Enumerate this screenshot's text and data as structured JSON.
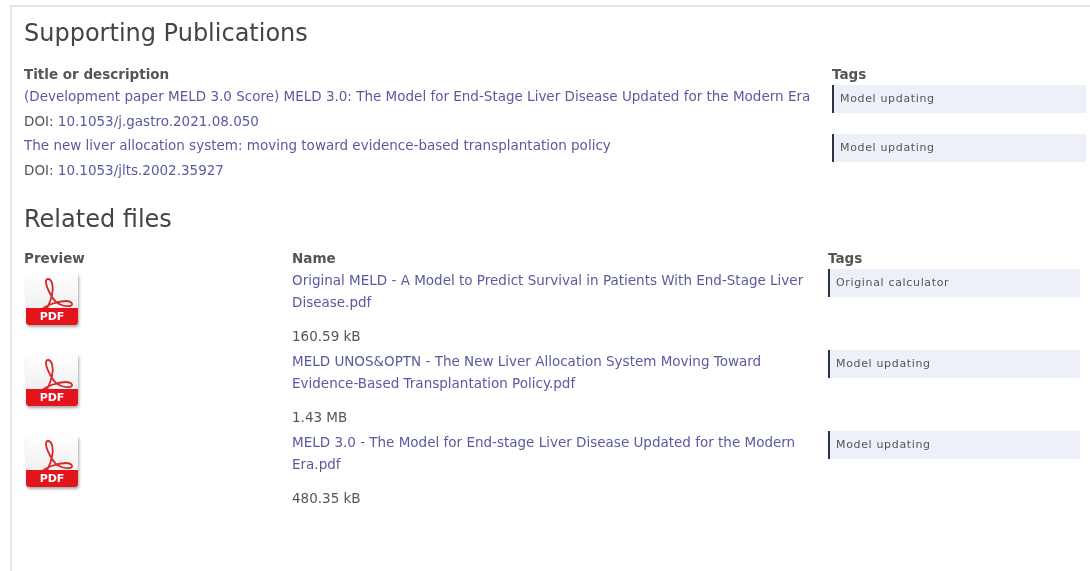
{
  "publications": {
    "title": "Supporting Publications",
    "columns": [
      "Title or description",
      "Tags"
    ],
    "rows": [
      {
        "title": "(Development paper MELD 3.0 Score) MELD 3.0: The Model for End-Stage Liver Disease Updated for the Modern Era",
        "doi_label": "DOI:",
        "doi": "10.1053/j.gastro.2021.08.050",
        "tags": [
          "Model updating"
        ]
      },
      {
        "title": "The new liver allocation system: moving toward evidence-based transplantation policy",
        "doi_label": "DOI:",
        "doi": "10.1053/jlts.2002.35927",
        "tags": [
          "Model updating"
        ]
      }
    ]
  },
  "files": {
    "title": "Related files",
    "columns": [
      "Preview",
      "Name",
      "Tags"
    ],
    "rows": [
      {
        "icon_label": "PDF",
        "name": "Original MELD - A Model to Predict Survival in Patients With End-Stage Liver Disease.pdf",
        "size": "160.59 kB",
        "tags": [
          "Original calculator"
        ]
      },
      {
        "icon_label": "PDF",
        "name": "MELD UNOS&OPTN - The New Liver Allocation System Moving Toward Evidence-Based Transplantation Policy.pdf",
        "size": "1.43 MB",
        "tags": [
          "Model updating"
        ]
      },
      {
        "icon_label": "PDF",
        "name": "MELD 3.0 - The Model for End-stage Liver Disease Updated for the Modern Era.pdf",
        "size": "480.35 kB",
        "tags": [
          "Model updating"
        ]
      }
    ]
  }
}
